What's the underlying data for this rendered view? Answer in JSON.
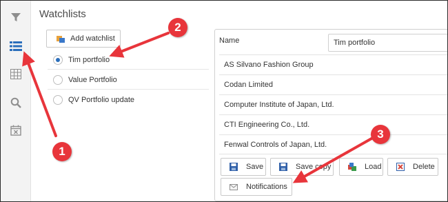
{
  "page": {
    "title": "Watchlists"
  },
  "sidebar": {
    "icons": [
      "filter-icon",
      "list-icon",
      "table-icon",
      "search-icon",
      "calendar-x-icon"
    ]
  },
  "watchlists": {
    "add_label": "Add watchlist",
    "items": [
      {
        "label": "Tim portfolio",
        "selected": true
      },
      {
        "label": "Value Portfolio",
        "selected": false
      },
      {
        "label": "QV Portfolio update",
        "selected": false
      }
    ]
  },
  "panel": {
    "name_label": "Name",
    "name_value": "Tim portfolio",
    "companies": [
      "AS Silvano Fashion Group",
      "Codan Limited",
      "Computer Institute of Japan, Ltd.",
      "CTI Engineering Co., Ltd.",
      "Fenwal Controls of Japan, Ltd."
    ],
    "buttons": {
      "save": "Save",
      "save_copy": "Save copy",
      "load": "Load",
      "delete": "Delete",
      "notifications": "Notifications"
    }
  },
  "annotations": {
    "one": "1",
    "two": "2",
    "three": "3"
  },
  "colors": {
    "accent": "#2a6ebb",
    "annotation": "#e8353b",
    "rail": "#f3f3f3"
  }
}
